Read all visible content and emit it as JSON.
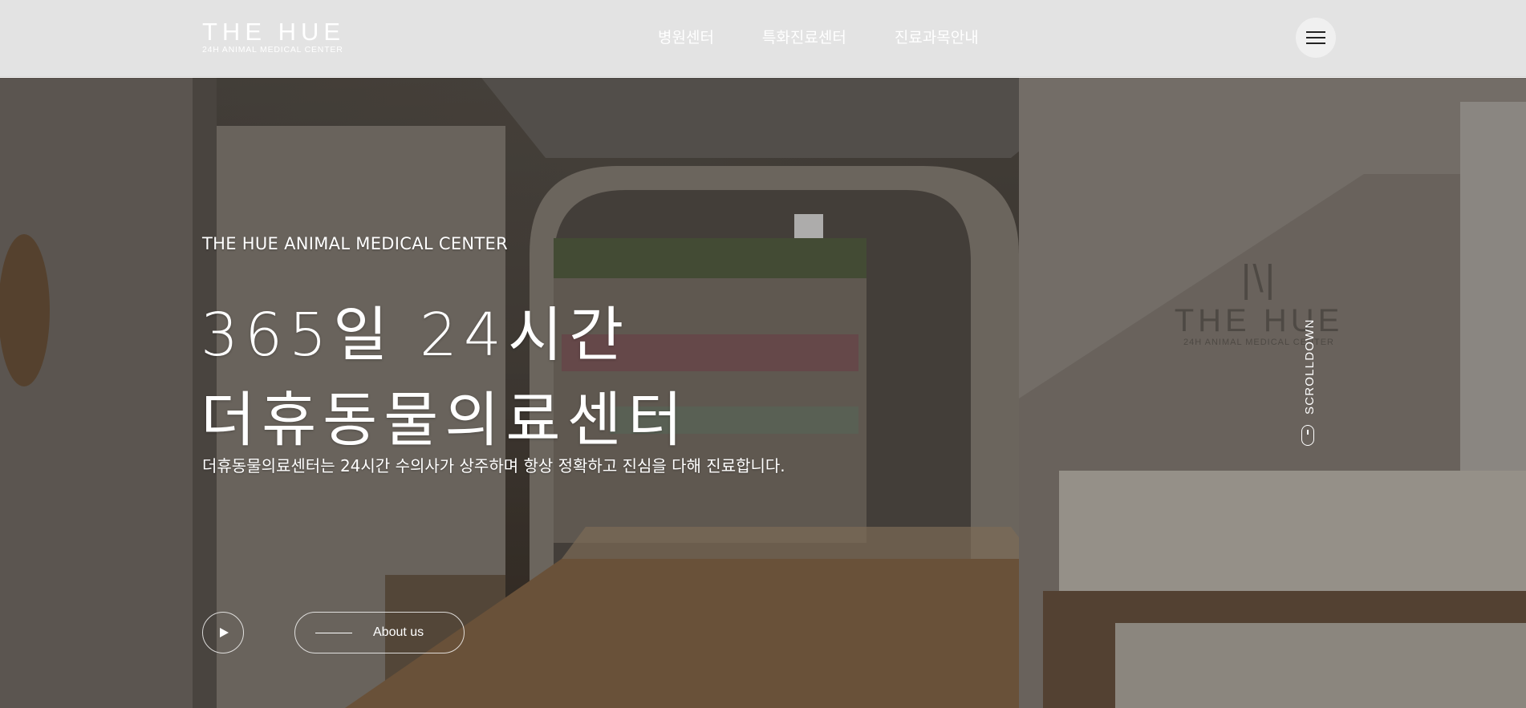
{
  "header": {
    "logo": {
      "title": "THE HUE",
      "subtitle": "24H ANIMAL MEDICAL CENTER"
    },
    "nav": [
      {
        "label": "병원센터"
      },
      {
        "label": "특화진료센터"
      },
      {
        "label": "진료과목안내"
      }
    ],
    "menu_icon": "hamburger-icon"
  },
  "hero": {
    "eyebrow": "THE HUE ANIMAL MEDICAL CENTER",
    "title_line1": "365일 24시간",
    "title_line2": "더휴동물의료센터",
    "description": "더휴동물의료센터는 24시간 수의사가 상주하며 항상 정확하고 진심을 다해 진료합니다.",
    "play_icon": "play-icon",
    "about_label": "About us",
    "scroll_label": "SCROLLDOWN",
    "scroll_icon": "mouse-icon",
    "wall_sign": {
      "title": "THE HUE",
      "subtitle": "24H ANIMAL MEDICAL CENTER"
    }
  },
  "colors": {
    "header_bg": "#e3e3e3",
    "text": "#ffffff",
    "menu_button_bg": "#f0f0f0"
  }
}
